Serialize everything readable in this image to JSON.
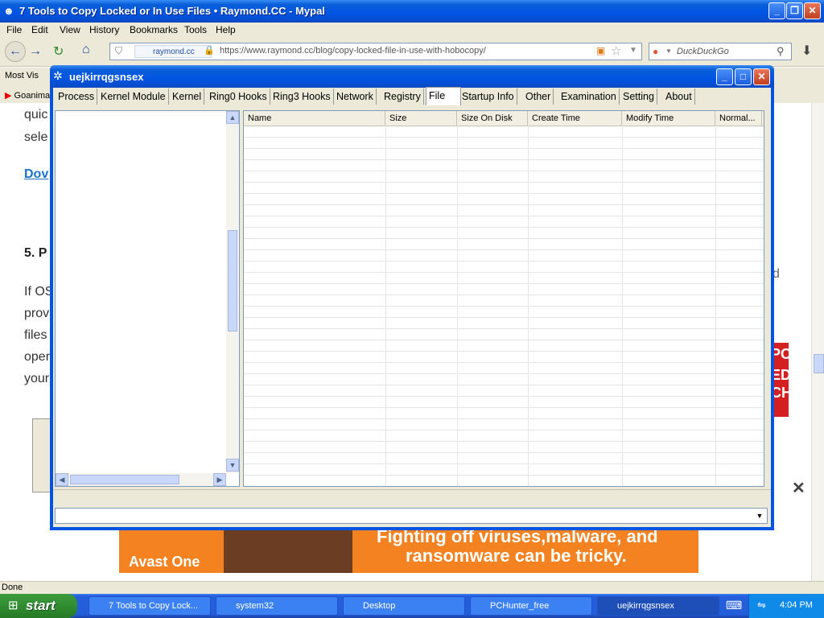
{
  "browser": {
    "title": "7 Tools to Copy Locked or In Use Files • Raymond.CC - Mypal",
    "menu": [
      "File",
      "Edit",
      "View",
      "History",
      "Bookmarks",
      "Tools",
      "Help"
    ],
    "site_identity": "raymond.cc",
    "url": "https://www.raymond.cc/blog/copy-locked-file-in-use-with-hobocopy/",
    "search_placeholder": "DuckDuckGo",
    "bookmarks": [
      "Most Vis",
      "Goanima"
    ],
    "status": "Done"
  },
  "page": {
    "fragments": [
      "quic",
      "sele",
      "Dov",
      "5. P",
      "If OS",
      "prov",
      "files",
      "oper",
      "your"
    ],
    "right_fragments": [
      "d",
      "PC",
      "ED",
      "CH"
    ],
    "close_glyph": "✕"
  },
  "ad": {
    "line1": "Fighting off viruses,malware, and",
    "line2": "ransomware can be tricky.",
    "brand": "Avast One"
  },
  "app": {
    "title": "uejkirrqgsnsex",
    "tabs": [
      "Process",
      "Kernel Module",
      "Kernel",
      "Ring0 Hooks",
      "Ring3 Hooks",
      "Network",
      "Registry",
      "File",
      "Startup Info",
      "Other",
      "Examination",
      "Setting",
      "About"
    ],
    "selected_tab": "File",
    "columns": [
      "Name",
      "Size",
      "Size On Disk",
      "Create Time",
      "Modify Time",
      "Normal..."
    ]
  },
  "taskbar": {
    "start": "start",
    "tasks": [
      "7 Tools to Copy Lock...",
      "system32",
      "Desktop",
      "PCHunter_free",
      "uejkirrqgsnsex"
    ],
    "clock": "4:04 PM"
  },
  "icons": [
    "back-icon",
    "forward-icon",
    "reload-icon",
    "home-icon",
    "star-icon",
    "download-icon",
    "search-icon",
    "minimize-icon",
    "maximize-icon",
    "close-icon"
  ]
}
